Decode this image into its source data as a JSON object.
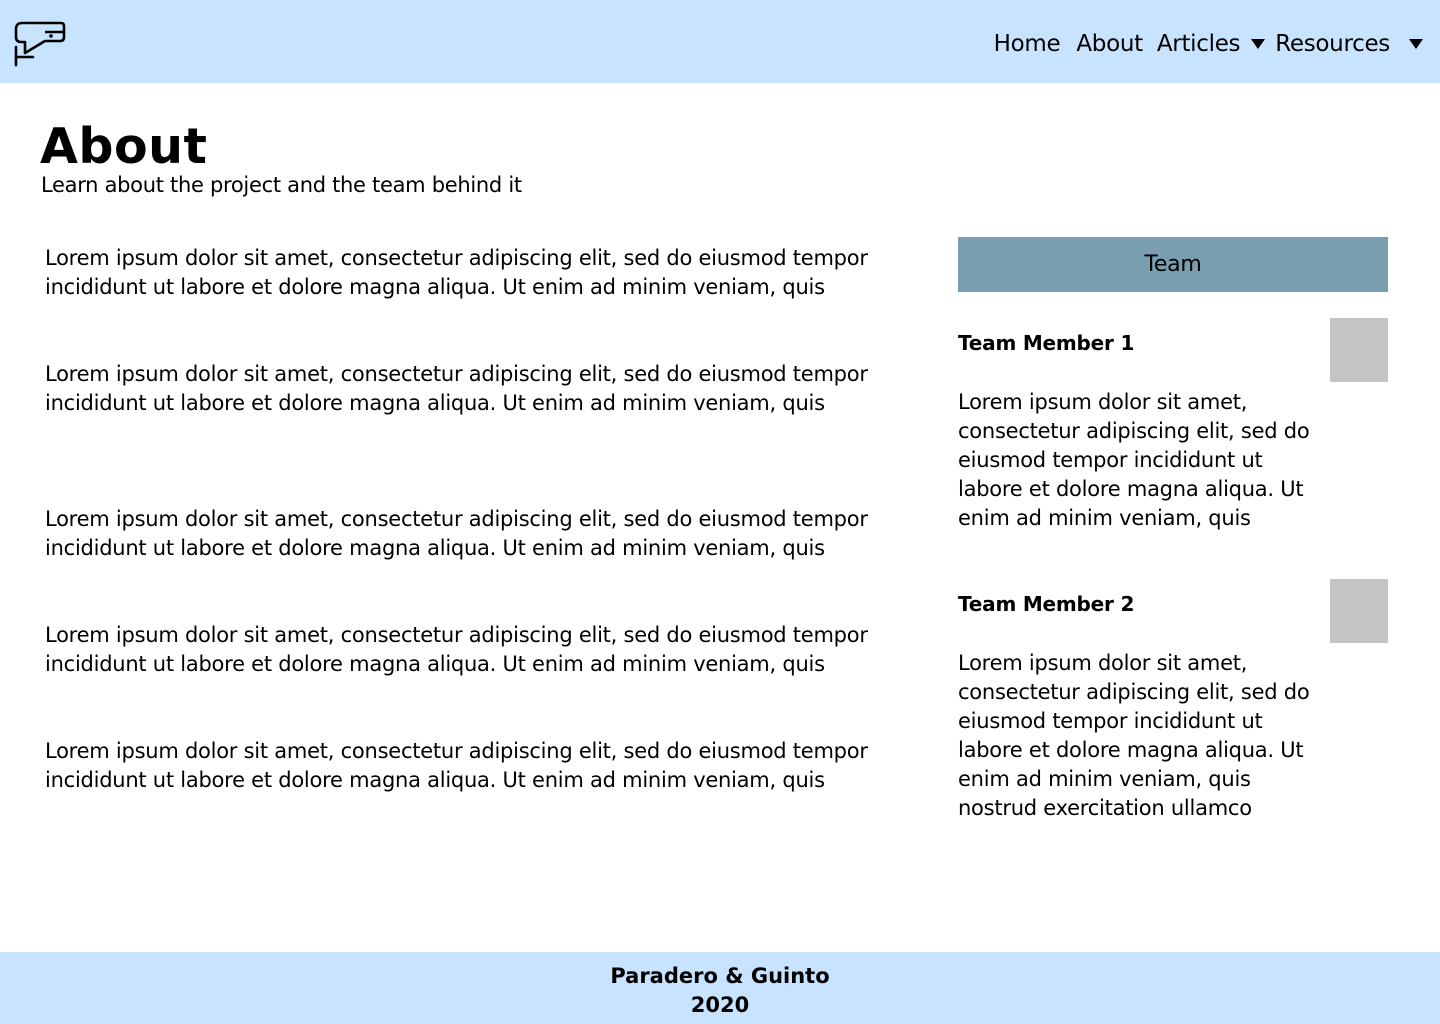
{
  "header": {
    "logo_icon": "speech-bubble-logo-icon",
    "nav": {
      "home": "Home",
      "about": "About",
      "articles": "Articles",
      "resources": "Resources"
    }
  },
  "page": {
    "title": "About",
    "subtitle": "Learn about the project and the team behind it"
  },
  "main": {
    "paragraphs": [
      "Lorem ipsum dolor sit amet, consectetur adipiscing elit, sed do eiusmod tempor incididunt ut labore et dolore magna aliqua. Ut enim ad minim veniam, quis",
      "Lorem ipsum dolor sit amet, consectetur adipiscing elit, sed do eiusmod tempor incididunt ut labore et dolore magna aliqua. Ut enim ad minim veniam, quis",
      "Lorem ipsum dolor sit amet, consectetur adipiscing elit, sed do eiusmod tempor incididunt ut labore et dolore magna aliqua. Ut enim ad minim veniam, quis",
      "Lorem ipsum dolor sit amet, consectetur adipiscing elit, sed do eiusmod tempor incididunt ut labore et dolore magna aliqua. Ut enim ad minim veniam, quis",
      "Lorem ipsum dolor sit amet, consectetur adipiscing elit, sed do eiusmod tempor incididunt ut labore et dolore magna aliqua. Ut enim ad minim veniam, quis"
    ]
  },
  "team": {
    "header": "Team",
    "members": [
      {
        "name": "Team Member 1",
        "bio": "Lorem ipsum dolor sit amet, consectetur adipiscing elit, sed do eiusmod tempor incididunt ut labore et dolore magna aliqua. Ut enim ad minim veniam, quis"
      },
      {
        "name": "Team Member 2",
        "bio": "Lorem ipsum dolor sit amet, consectetur adipiscing elit, sed do eiusmod tempor incididunt ut labore et dolore magna aliqua. Ut enim ad minim veniam, quis nostrud exercitation ullamco"
      }
    ]
  },
  "footer": {
    "line1": "Paradero & Guinto",
    "line2": "2020"
  },
  "colors": {
    "header_bg": "#c8e3fe",
    "team_header_bg": "#789eb0",
    "photo_placeholder": "#c4c4c4"
  }
}
